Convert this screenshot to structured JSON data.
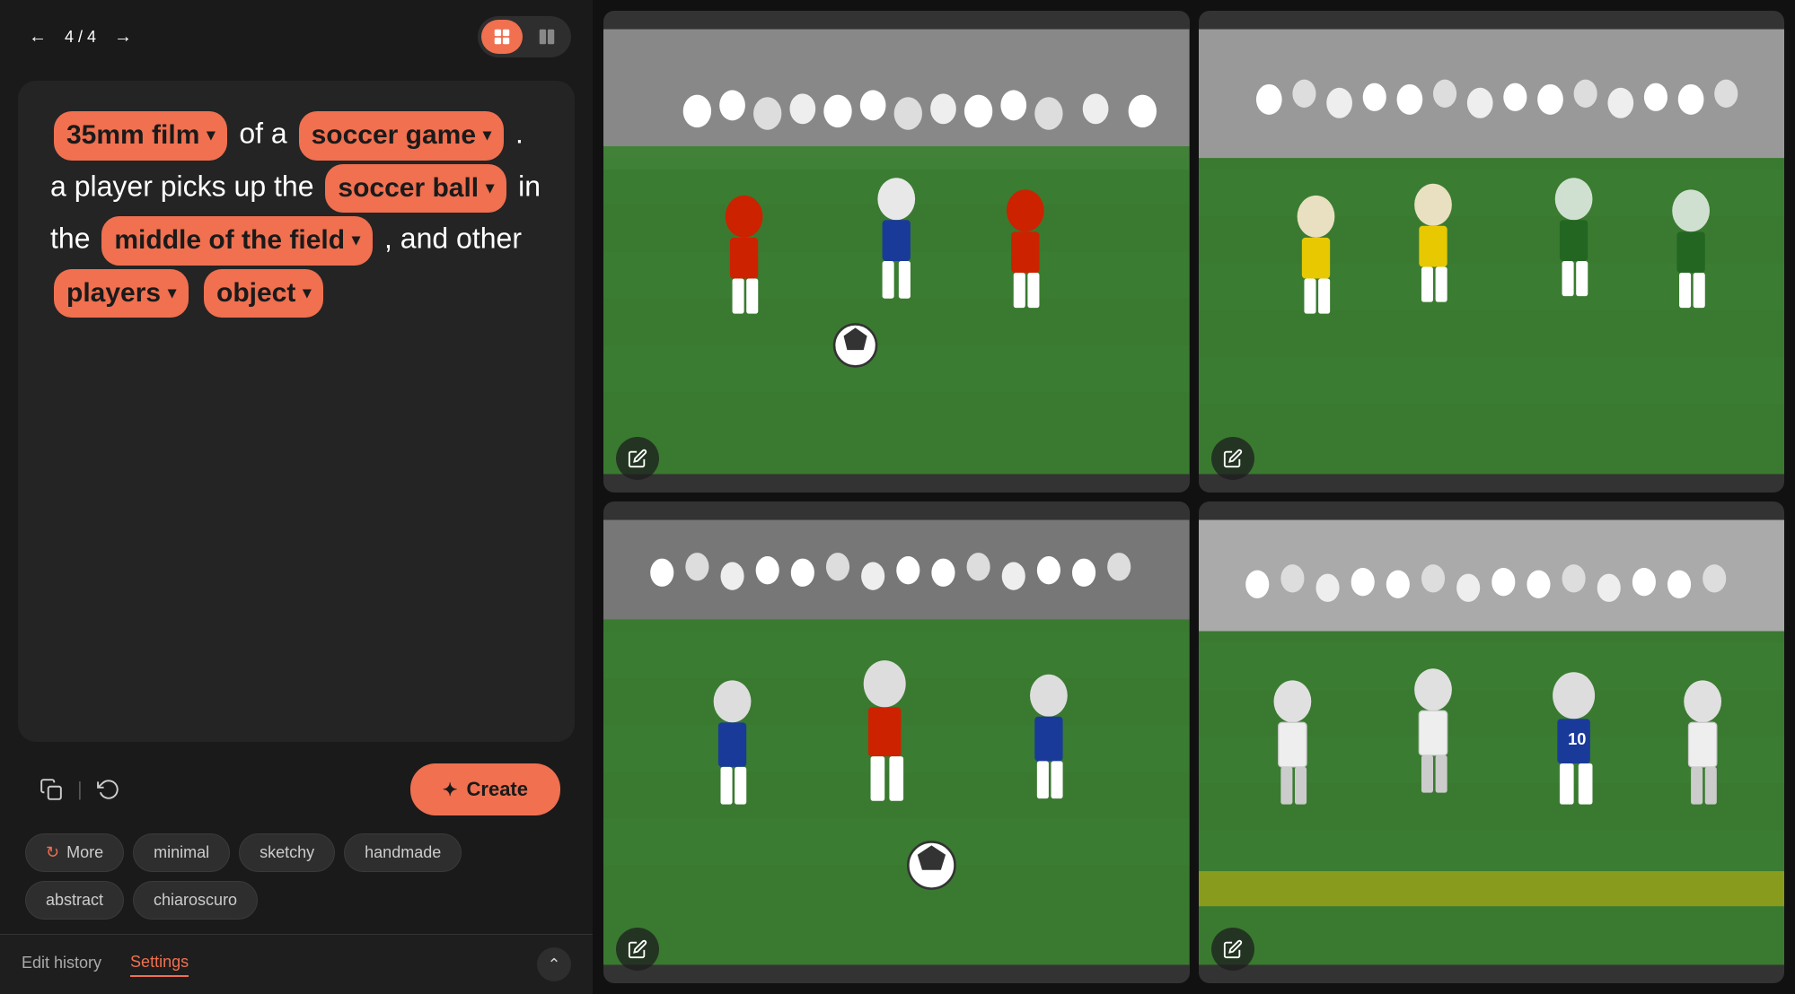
{
  "nav": {
    "back_arrow": "←",
    "forward_arrow": "→",
    "counter": "4 / 4",
    "grid_icon": "⊞",
    "split_icon": "⊟"
  },
  "prompt": {
    "chip_film": "35mm film",
    "text_of_a": "of a",
    "chip_soccer_game": "soccer game",
    "text_period_a": ". a player picks up the",
    "chip_soccer_ball": "soccer ball",
    "text_in_the": "in the",
    "chip_middle": "middle of the field",
    "text_and_other": ", and other",
    "chip_players": "players",
    "chip_object": "object"
  },
  "actions": {
    "copy_icon": "⧉",
    "refresh_icon": "↺",
    "create_label": "✦ Create"
  },
  "styles": {
    "more_label": "More",
    "pills": [
      "minimal",
      "sketchy",
      "handmade",
      "abstract",
      "chiaroscuro"
    ]
  },
  "bottom": {
    "edit_history_label": "Edit history",
    "settings_label": "Settings",
    "expand_icon": "⌃"
  },
  "images": {
    "edit_icon": "✏"
  }
}
